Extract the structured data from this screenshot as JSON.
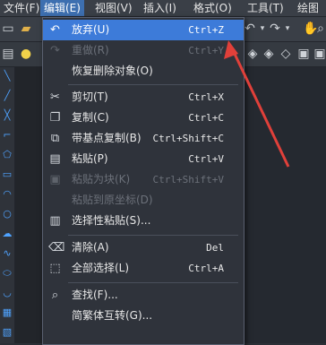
{
  "menubar": {
    "items": [
      "文件(F)",
      "编辑(E)",
      "视图(V)",
      "插入(I)",
      "格式(O)",
      "工具(T)",
      "绘图"
    ]
  },
  "edit_menu": {
    "items": [
      {
        "label": "放弃(U)",
        "shortcut": "Ctrl+Z",
        "icon": "undo-icon",
        "enabled": true,
        "highlighted": true
      },
      {
        "label": "重做(R)",
        "shortcut": "Ctrl+Y",
        "icon": "redo-icon",
        "enabled": false
      },
      {
        "label": "恢复删除对象(O)",
        "shortcut": "",
        "icon": "",
        "enabled": true
      },
      {
        "label": "剪切(T)",
        "shortcut": "Ctrl+X",
        "icon": "scissors-icon",
        "enabled": true
      },
      {
        "label": "复制(C)",
        "shortcut": "Ctrl+C",
        "icon": "copy-icon",
        "enabled": true
      },
      {
        "label": "带基点复制(B)",
        "shortcut": "Ctrl+Shift+C",
        "icon": "copy-basepoint-icon",
        "enabled": true
      },
      {
        "label": "粘贴(P)",
        "shortcut": "Ctrl+V",
        "icon": "paste-icon",
        "enabled": true
      },
      {
        "label": "粘贴为块(K)",
        "shortcut": "Ctrl+Shift+V",
        "icon": "paste-block-icon",
        "enabled": false
      },
      {
        "label": "粘贴到原坐标(D)",
        "shortcut": "",
        "icon": "",
        "enabled": false
      },
      {
        "label": "选择性粘贴(S)...",
        "shortcut": "",
        "icon": "paste-special-icon",
        "enabled": true
      },
      {
        "label": "清除(A)",
        "shortcut": "Del",
        "icon": "eraser-icon",
        "enabled": true
      },
      {
        "label": "全部选择(L)",
        "shortcut": "Ctrl+A",
        "icon": "select-all-icon",
        "enabled": true
      },
      {
        "label": "查找(F)...",
        "shortcut": "",
        "icon": "find-icon",
        "enabled": true
      },
      {
        "label": "简繁体互转(G)...",
        "shortcut": "",
        "icon": "",
        "enabled": true
      }
    ]
  },
  "colors": {
    "highlight": "#3d7bd9",
    "annotation_arrow": "#e0403a"
  }
}
